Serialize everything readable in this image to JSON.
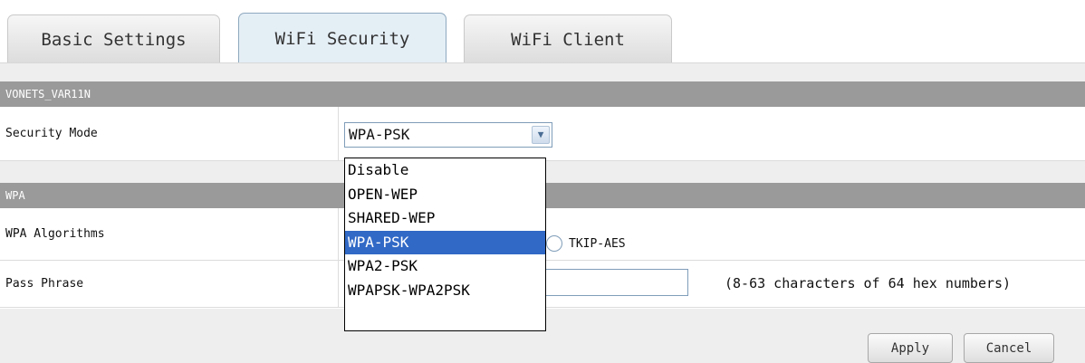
{
  "tabs": [
    {
      "label": "Basic Settings",
      "active": false
    },
    {
      "label": "WiFi Security",
      "active": true
    },
    {
      "label": "WiFi Client",
      "active": false
    }
  ],
  "network": {
    "ssid_header": "VONETS_VAR11N"
  },
  "security_mode": {
    "label": "Security Mode",
    "selected": "WPA-PSK",
    "options": [
      "Disable",
      "OPEN-WEP",
      "SHARED-WEP",
      "WPA-PSK",
      "WPA2-PSK",
      "WPAPSK-WPA2PSK"
    ],
    "highlighted": "WPA-PSK"
  },
  "wpa": {
    "header": "WPA",
    "algorithms_label": "WPA Algorithms",
    "algorithm_option": "TKIP-AES",
    "pass_phrase_label": "Pass Phrase",
    "pass_phrase_value": "",
    "pass_phrase_hint": "(8-63 characters of 64 hex numbers)"
  },
  "buttons": {
    "apply": "Apply",
    "cancel": "Cancel"
  },
  "colors": {
    "header_bar": "#9a9a9a",
    "selected_option": "#3169c6",
    "active_tab": "#e4eef5"
  }
}
